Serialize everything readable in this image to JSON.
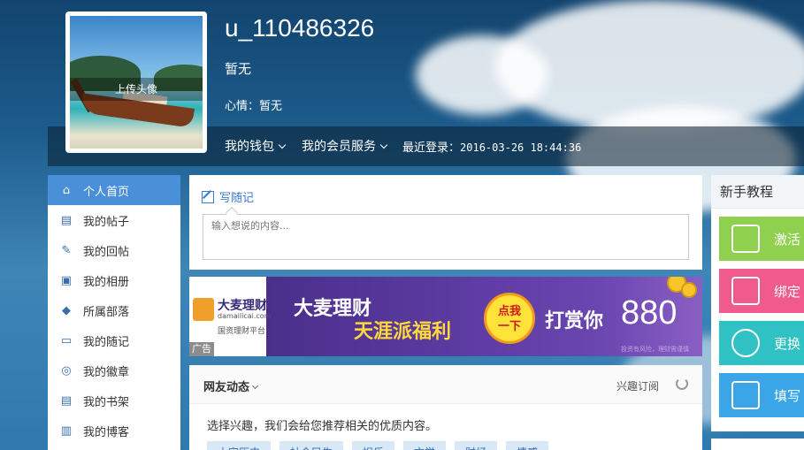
{
  "profile": {
    "username": "u_110486326",
    "intro": "暂无",
    "mood": "心情：暂无",
    "upload_avatar": "上传头像"
  },
  "infobar": {
    "wallet": "我的钱包",
    "member_service": "我的会员服务",
    "last_login_label": "最近登录：",
    "last_login_time": "2016-03-26 18:44:36"
  },
  "sidebar": {
    "items": [
      {
        "label": "个人首页",
        "icon": "home-icon"
      },
      {
        "label": "我的帖子",
        "icon": "document-icon"
      },
      {
        "label": "我的回帖",
        "icon": "edit-icon"
      },
      {
        "label": "我的相册",
        "icon": "photo-icon"
      },
      {
        "label": "所属部落",
        "icon": "group-icon"
      },
      {
        "label": "我的随记",
        "icon": "chat-icon"
      },
      {
        "label": "我的徽章",
        "icon": "badge-icon"
      },
      {
        "label": "我的书架",
        "icon": "book-icon"
      },
      {
        "label": "我的博客",
        "icon": "blog-icon"
      }
    ]
  },
  "composer": {
    "write_label": "写随记",
    "placeholder": "输入想说的内容..."
  },
  "ad": {
    "brand": "大麦理财",
    "domain": "damailicai.com",
    "subtitle": "国资理财平台",
    "line1": "大麦理财",
    "line2": "天涯派福利",
    "button_line1": "点我",
    "button_line2": "一下",
    "reward": "打赏你",
    "amount": "880",
    "disclaimer": "投资有风险，理财需谨慎",
    "tag": "广告"
  },
  "feed": {
    "title": "网友动态",
    "subscribe": "兴趣订阅",
    "hint": "选择兴趣，我们会给您推荐相关的优质内容。",
    "tags": [
      "大家历史",
      "社会民生",
      "娱乐",
      "文学",
      "财经",
      "情感"
    ]
  },
  "tutorial": {
    "title": "新手教程",
    "items": [
      {
        "label": "激活",
        "color": "#8fd14f",
        "icon": "phone-icon"
      },
      {
        "label": "绑定",
        "color": "#f05a8c",
        "icon": "mail-icon"
      },
      {
        "label": "更换",
        "color": "#2fc1c4",
        "icon": "user-icon"
      },
      {
        "label": "填写",
        "color": "#3aa6e8",
        "icon": "form-icon"
      }
    ]
  }
}
